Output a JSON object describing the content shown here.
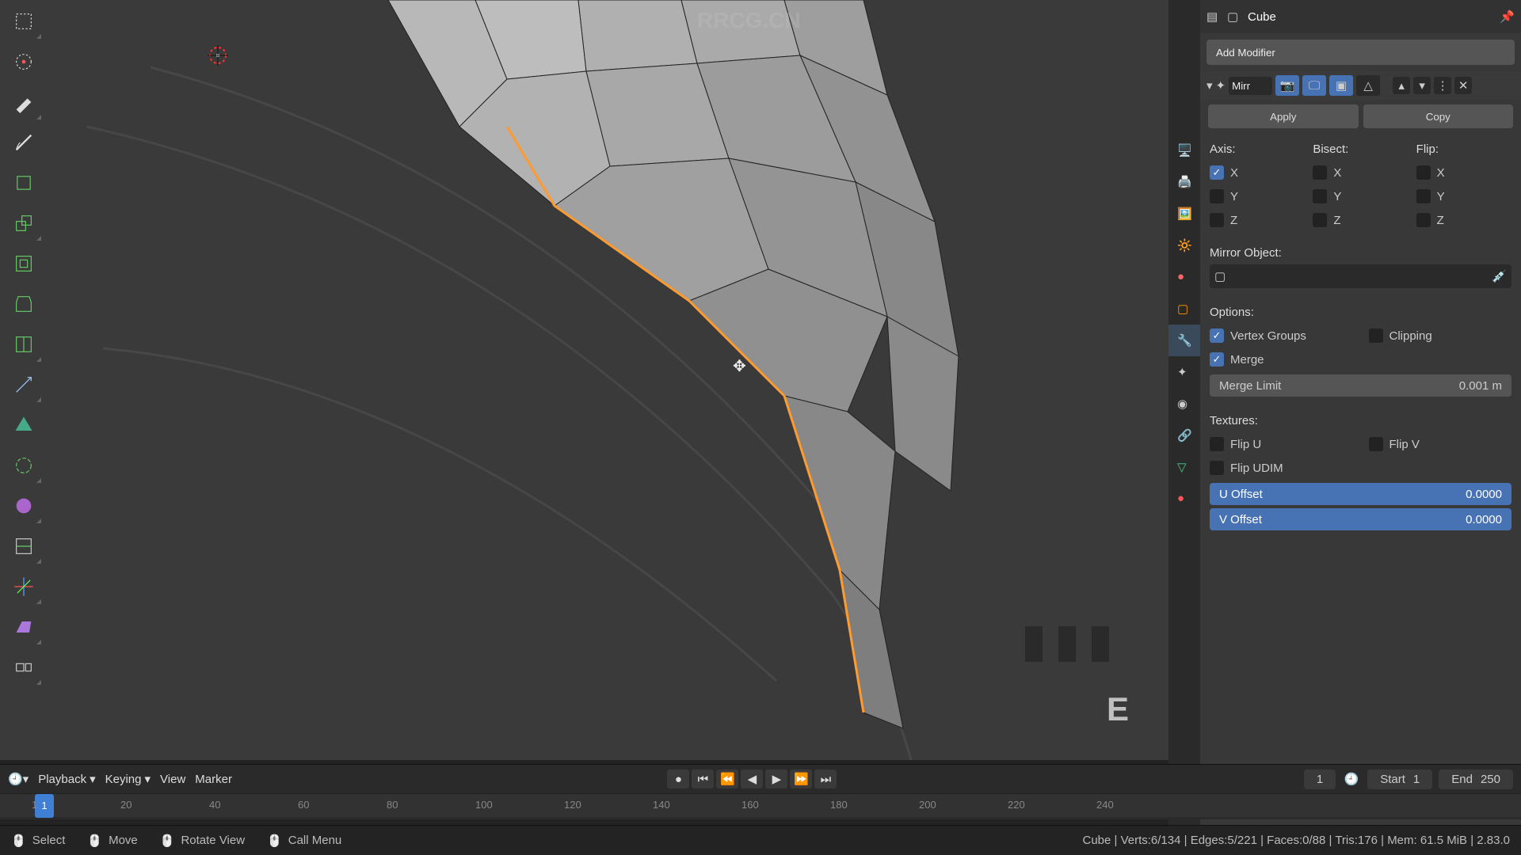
{
  "watermark": "RRCG.CN",
  "object_name": "Cube",
  "add_modifier_label": "Add Modifier",
  "modifier": {
    "name": "Mirr",
    "apply": "Apply",
    "copy": "Copy",
    "axis_label": "Axis:",
    "bisect_label": "Bisect:",
    "flip_label": "Flip:",
    "x": "X",
    "y": "Y",
    "z": "Z",
    "mirror_object_label": "Mirror Object:",
    "options_label": "Options:",
    "vertex_groups": "Vertex Groups",
    "clipping": "Clipping",
    "merge": "Merge",
    "merge_limit_label": "Merge Limit",
    "merge_limit_value": "0.001 m",
    "textures_label": "Textures:",
    "flip_u": "Flip U",
    "flip_v": "Flip V",
    "flip_udim": "Flip UDIM",
    "u_offset_label": "U Offset",
    "u_offset_value": "0.0000",
    "v_offset_label": "V Offset",
    "v_offset_value": "0.0000"
  },
  "key_pressed": "E",
  "timeline": {
    "playback": "Playback",
    "keying": "Keying",
    "view": "View",
    "marker": "Marker",
    "current": "1",
    "start_label": "Start",
    "start_value": "1",
    "end_label": "End",
    "end_value": "250",
    "ticks": [
      "1",
      "20",
      "40",
      "60",
      "80",
      "100",
      "120",
      "140",
      "160",
      "180",
      "200",
      "220",
      "240"
    ]
  },
  "status": {
    "select": "Select",
    "move": "Move",
    "rotate": "Rotate View",
    "menu": "Call Menu",
    "stats": "Cube | Verts:6/134 | Edges:5/221 | Faces:0/88 | Tris:176 | Mem: 61.5 MiB | 2.83.0"
  }
}
